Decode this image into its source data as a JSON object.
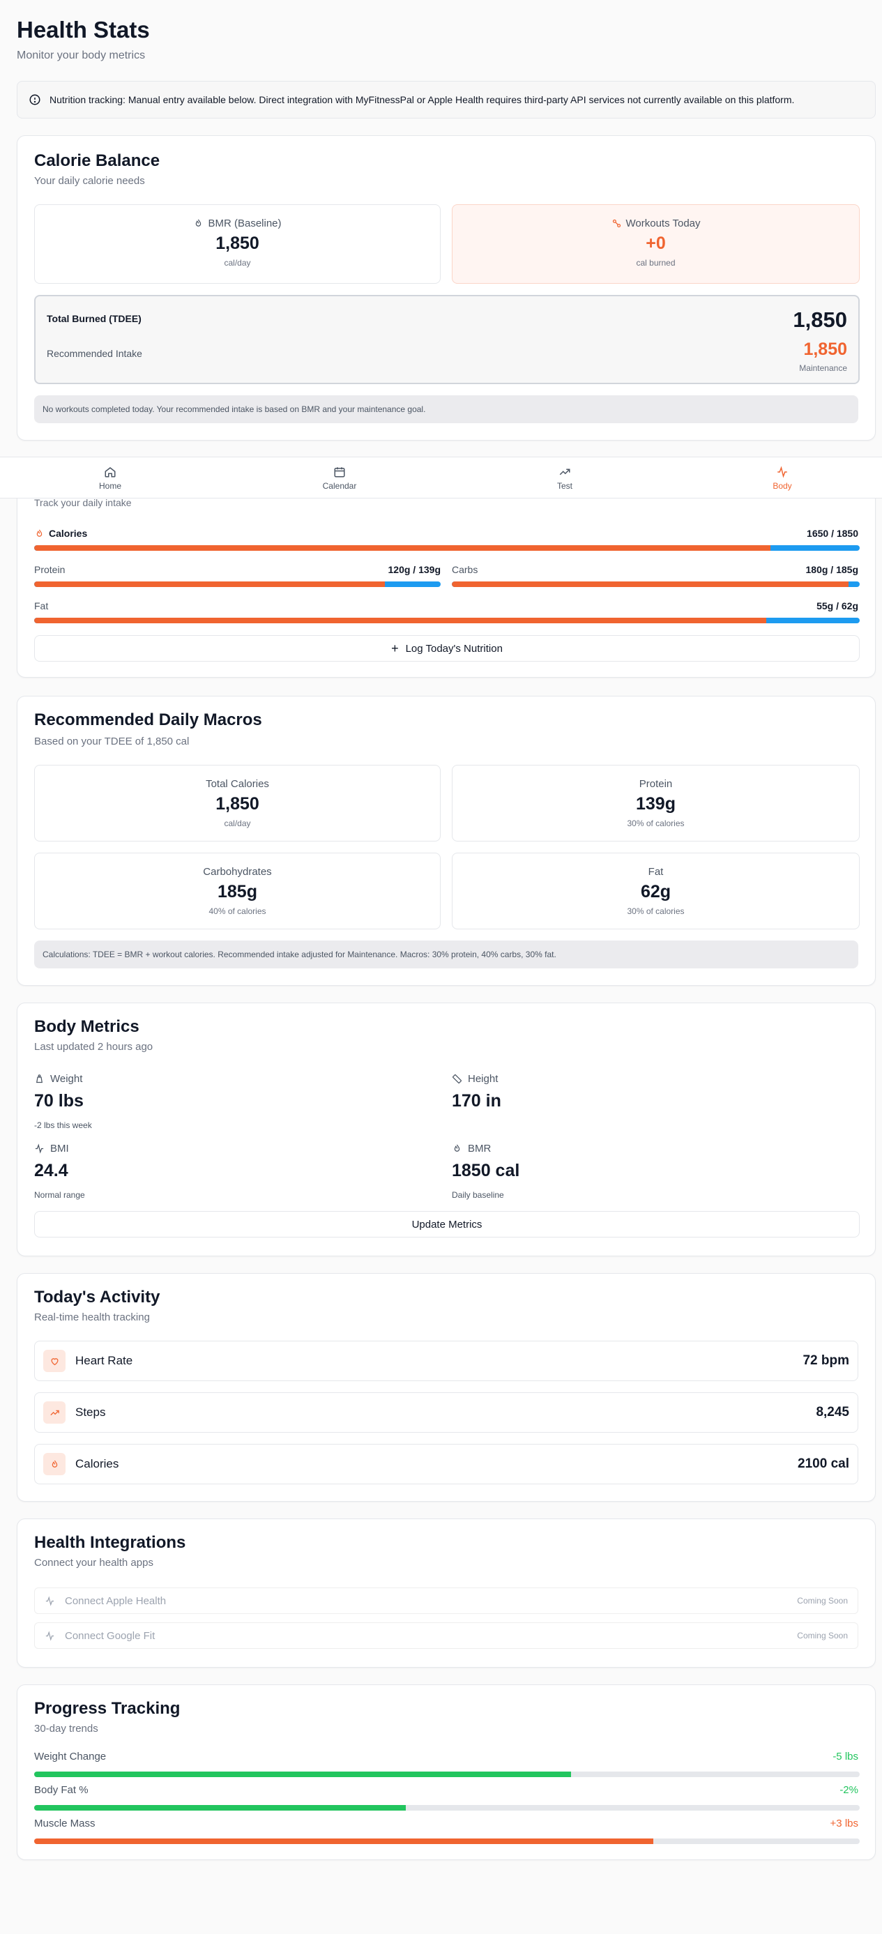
{
  "header": {
    "title": "Health Stats",
    "subtitle": "Monitor your body metrics"
  },
  "alert": {
    "text": "Nutrition tracking: Manual entry available below. Direct integration with MyFitnessPal or Apple Health requires third-party API services not currently available on this platform."
  },
  "calorie_balance": {
    "title": "Calorie Balance",
    "subtitle": "Your daily calorie needs",
    "bmr": {
      "label": "BMR (Baseline)",
      "value": "1,850",
      "unit": "cal/day"
    },
    "workouts": {
      "label": "Workouts Today",
      "value": "+0",
      "unit": "cal burned"
    },
    "tdee_label": "Total Burned (TDEE)",
    "tdee_value": "1,850",
    "intake_label": "Recommended Intake",
    "intake_value": "1,850",
    "intake_goal": "Maintenance",
    "note": "No workouts completed today. Your recommended intake is based on BMR and your maintenance goal."
  },
  "nav": {
    "items": [
      {
        "label": "Home",
        "icon": "home-icon"
      },
      {
        "label": "Calendar",
        "icon": "calendar-icon"
      },
      {
        "label": "Test",
        "icon": "trending-up-icon"
      },
      {
        "label": "Body",
        "icon": "activity-icon"
      }
    ],
    "active": "Body"
  },
  "intake": {
    "subtitle": "Track your daily intake",
    "calories": {
      "label": "Calories",
      "value": "1650 / 1850",
      "fraction": 0.892
    },
    "protein": {
      "label": "Protein",
      "value": "120g / 139g",
      "fraction": 0.863
    },
    "carbs": {
      "label": "Carbs",
      "value": "180g / 185g",
      "fraction": 0.973
    },
    "fat": {
      "label": "Fat",
      "value": "55g / 62g",
      "fraction": 0.887
    },
    "log_button": "Log Today's Nutrition"
  },
  "macros": {
    "title": "Recommended Daily Macros",
    "subtitle": "Based on your TDEE of 1,850 cal",
    "total": {
      "label": "Total Calories",
      "value": "1,850",
      "sub": "cal/day"
    },
    "protein": {
      "label": "Protein",
      "value": "139g",
      "sub": "30% of calories"
    },
    "carbs": {
      "label": "Carbohydrates",
      "value": "185g",
      "sub": "40% of calories"
    },
    "fat": {
      "label": "Fat",
      "value": "62g",
      "sub": "30% of calories"
    },
    "note": "Calculations: TDEE = BMR + workout calories. Recommended intake adjusted for Maintenance. Macros: 30% protein, 40% carbs, 30% fat."
  },
  "body_metrics": {
    "title": "Body Metrics",
    "subtitle": "Last updated 2 hours ago",
    "weight": {
      "label": "Weight",
      "value": "70 lbs",
      "sub": "-2 lbs this week"
    },
    "height": {
      "label": "Height",
      "value": "170 in"
    },
    "bmi": {
      "label": "BMI",
      "value": "24.4",
      "sub": "Normal range"
    },
    "bmr": {
      "label": "BMR",
      "value": "1850 cal",
      "sub": "Daily baseline"
    },
    "update_button": "Update Metrics"
  },
  "activity": {
    "title": "Today's Activity",
    "subtitle": "Real-time health tracking",
    "items": [
      {
        "name": "Heart Rate",
        "value": "72 bpm",
        "icon": "heart-icon"
      },
      {
        "name": "Steps",
        "value": "8,245",
        "icon": "trending-up-icon"
      },
      {
        "name": "Calories",
        "value": "2100 cal",
        "icon": "flame-icon"
      }
    ]
  },
  "integrations": {
    "title": "Health Integrations",
    "subtitle": "Connect your health apps",
    "items": [
      {
        "label": "Connect Apple Health",
        "status": "Coming Soon"
      },
      {
        "label": "Connect Google Fit",
        "status": "Coming Soon"
      }
    ]
  },
  "progress": {
    "title": "Progress Tracking",
    "subtitle": "30-day trends",
    "items": [
      {
        "label": "Weight Change",
        "value": "-5 lbs",
        "fraction": 0.65,
        "color": "#22c55e"
      },
      {
        "label": "Body Fat %",
        "value": "-2%",
        "fraction": 0.45,
        "color": "#22c55e"
      },
      {
        "label": "Muscle Mass",
        "value": "+3 lbs",
        "fraction": 0.75,
        "color": "#f06430"
      }
    ]
  },
  "colors": {
    "accent": "#f06430",
    "secondary_bar": "#1d9bf0",
    "positive": "#22c55e"
  }
}
